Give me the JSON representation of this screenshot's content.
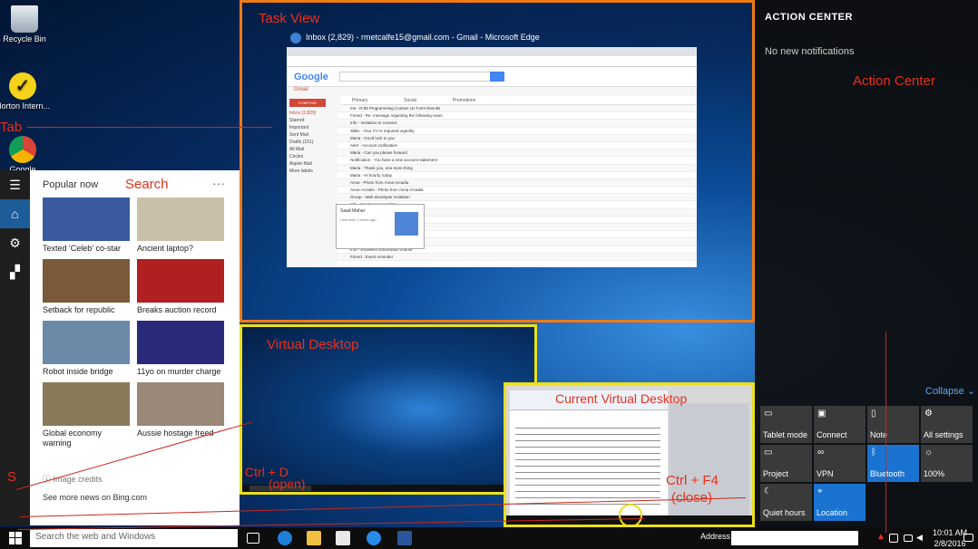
{
  "desktop_icons": [
    {
      "label": "Recycle Bin",
      "icon": "recycle-bin-icon"
    },
    {
      "label": "Norton Intern...",
      "icon": "norton-icon"
    },
    {
      "label": "Google",
      "icon": "chrome-icon"
    }
  ],
  "annotations": {
    "task_view": "Task View",
    "tab": "Tab",
    "search": "Search",
    "action_center": "Action Center",
    "virtual_desktop": "Virtual Desktop",
    "current_virtual_desktop": "Current Virtual Desktop",
    "ctrl_d": "Ctrl + D",
    "open": "(open)",
    "ctrl_f4": "Ctrl + F4",
    "close": "(close)",
    "s": "S"
  },
  "task_view": {
    "window_title": "Inbox (2,829) - rmetcalfe15@gmail.com - Gmail - Microsoft Edge",
    "gmail_logo": "Google",
    "gmail_label": "Gmail",
    "compose": "COMPOSE",
    "folders": [
      "Inbox (2,829)",
      "Starred",
      "Important",
      "Sent Mail",
      "Drafts (151)",
      "All Mail",
      "Circles",
      "Aspire Mail",
      "More labels"
    ],
    "tabs": [
      "Primary",
      "Social",
      "Promotions"
    ],
    "emails": [
      "me - RJM Programming Contact Us Form Results",
      "Friend - Re: message regarding the following news",
      "Info - Invitation to connect",
      "Skills - Your CV is required urgently",
      "Maria - Good luck to you",
      "Alert - Account notification",
      "Maria - Can you please forward",
      "Notification - You have a new account statement",
      "Maria - Thank you, one more thing",
      "Maria - Hi hourly, today",
      "Anna - Photo from Anna Arcadia",
      "Anna Arcadia - Photo from Anna Arcadia",
      "Group - Web developer invitation",
      "Info - Sports news update",
      "Bank - Account security notice",
      "Alert - About Daily Newsletter",
      "Maria - Day note for future",
      "Info - Sydney daily news",
      "Hi hourly - Google Alert",
      "Info - Excellent certification course",
      "Friend - Event reminder"
    ],
    "hangout": {
      "name": "Saad Mahar",
      "status": "Last seen 3 hours ago"
    }
  },
  "start_menu": {
    "heading": "Popular now",
    "news": [
      {
        "caption": "Texted 'Celeb' co-star",
        "color": "#3a5aa0"
      },
      {
        "caption": "Ancient laptop?",
        "color": "#c8c0a8"
      },
      {
        "caption": "Setback for republic",
        "color": "#7a5a3a"
      },
      {
        "caption": "Breaks auction record",
        "color": "#b02020"
      },
      {
        "caption": "Robot inside bridge",
        "color": "#6a8aa8"
      },
      {
        "caption": "11yo on murder charge",
        "color": "#2a2a7a"
      },
      {
        "caption": "Global economy warning",
        "color": "#8a7a5a"
      },
      {
        "caption": "Aussie hostage freed",
        "color": "#9a8878"
      }
    ],
    "image_credits": "Image credits",
    "more_news": "See more news on Bing.com"
  },
  "taskbar": {
    "search_placeholder": "Search the web and Windows",
    "address_label": "Address",
    "time": "10:01 AM",
    "date": "2/8/2016"
  },
  "action_center": {
    "title": "ACTION CENTER",
    "no_notifications": "No new notifications",
    "collapse": "Collapse",
    "tiles": [
      {
        "label": "Tablet mode",
        "icon": "tablet-icon",
        "on": false
      },
      {
        "label": "Connect",
        "icon": "connect-icon",
        "on": false
      },
      {
        "label": "Note",
        "icon": "note-icon",
        "on": false
      },
      {
        "label": "All settings",
        "icon": "gear-icon",
        "on": false
      },
      {
        "label": "Project",
        "icon": "project-icon",
        "on": false
      },
      {
        "label": "VPN",
        "icon": "vpn-icon",
        "on": false
      },
      {
        "label": "Bluetooth",
        "icon": "bluetooth-icon",
        "on": true
      },
      {
        "label": "100%",
        "icon": "brightness-icon",
        "on": false
      },
      {
        "label": "Quiet hours",
        "icon": "moon-icon",
        "on": false
      },
      {
        "label": "Location",
        "icon": "location-icon",
        "on": true
      }
    ]
  }
}
